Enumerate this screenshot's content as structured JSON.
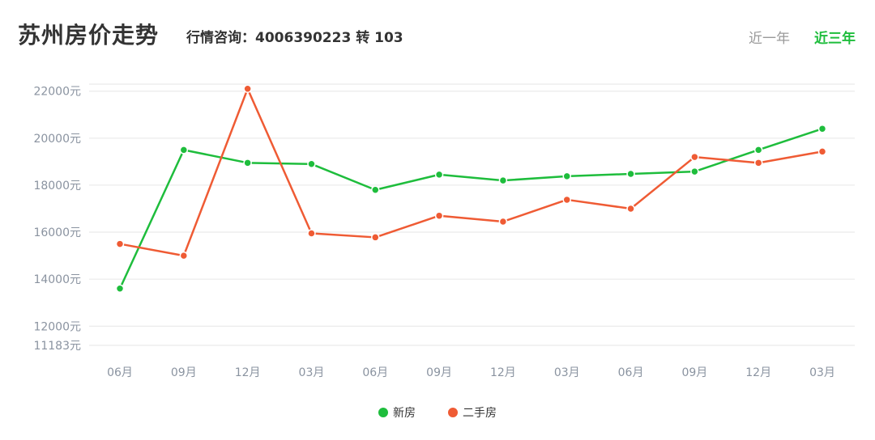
{
  "header": {
    "title": "苏州房价走势",
    "hotline": "行情咨询：4006390223 转 103",
    "range_tabs": [
      {
        "label": "近一年",
        "active": false
      },
      {
        "label": "近三年",
        "active": true
      }
    ]
  },
  "colors": {
    "new_house": "#1ebd3c",
    "second_hand": "#ef5b34",
    "active_tab": "#1ebd3c",
    "axis_text": "#8a93a0",
    "grid": "#e6e6e6"
  },
  "chart_data": {
    "type": "line",
    "title": "",
    "xlabel": "",
    "ylabel": "",
    "categories": [
      "06月",
      "09月",
      "12月",
      "03月",
      "06月",
      "09月",
      "12月",
      "03月",
      "06月",
      "09月",
      "12月",
      "03月"
    ],
    "series": [
      {
        "name": "新房",
        "color": "#1ebd3c",
        "values": [
          13600,
          19500,
          18950,
          18900,
          17800,
          18450,
          18200,
          18380,
          18480,
          18580,
          19500,
          20400
        ]
      },
      {
        "name": "二手房",
        "color": "#ef5b34",
        "values": [
          15500,
          15000,
          22100,
          15950,
          15780,
          16700,
          16450,
          17380,
          17000,
          19200,
          18950,
          19430
        ]
      }
    ],
    "ylim": [
      11183,
      22300
    ],
    "y_ticks": [
      {
        "value": 22000,
        "label": "22000元"
      },
      {
        "value": 20000,
        "label": "20000元"
      },
      {
        "value": 18000,
        "label": "18000元"
      },
      {
        "value": 16000,
        "label": "16000元"
      },
      {
        "value": 14000,
        "label": "14000元"
      },
      {
        "value": 12000,
        "label": "12000元"
      },
      {
        "value": 11183,
        "label": "11183元"
      }
    ],
    "grid": true,
    "legend_position": "bottom-center"
  }
}
